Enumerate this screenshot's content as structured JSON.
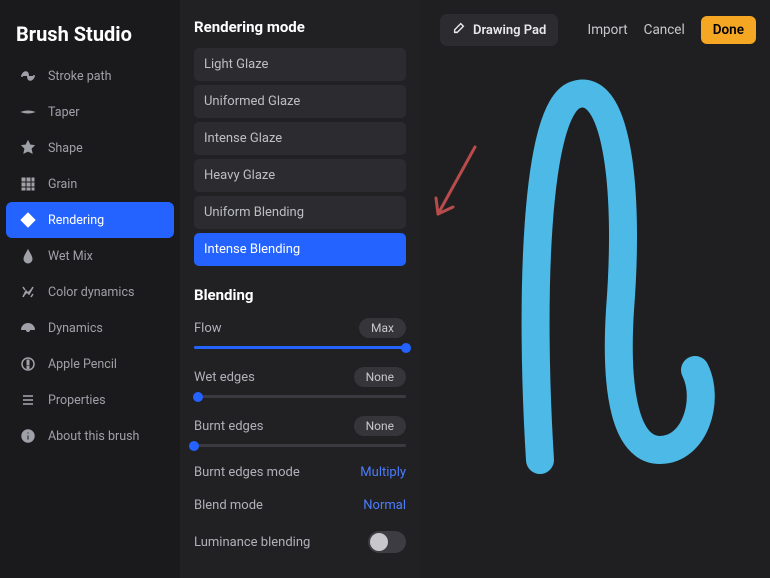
{
  "app_title": "Brush Studio",
  "sidebar": {
    "items": [
      {
        "label": "Stroke path",
        "icon": "stroke-path-icon"
      },
      {
        "label": "Taper",
        "icon": "taper-icon"
      },
      {
        "label": "Shape",
        "icon": "shape-icon"
      },
      {
        "label": "Grain",
        "icon": "grain-icon"
      },
      {
        "label": "Rendering",
        "icon": "rendering-icon",
        "active": true
      },
      {
        "label": "Wet Mix",
        "icon": "wet-mix-icon"
      },
      {
        "label": "Color dynamics",
        "icon": "color-dynamics-icon"
      },
      {
        "label": "Dynamics",
        "icon": "dynamics-icon"
      },
      {
        "label": "Apple Pencil",
        "icon": "apple-pencil-icon"
      },
      {
        "label": "Properties",
        "icon": "properties-icon"
      },
      {
        "label": "About this brush",
        "icon": "about-icon"
      }
    ]
  },
  "settings": {
    "heading": "Rendering mode",
    "modes": [
      {
        "label": "Light Glaze"
      },
      {
        "label": "Uniformed Glaze"
      },
      {
        "label": "Intense Glaze"
      },
      {
        "label": "Heavy Glaze"
      },
      {
        "label": "Uniform Blending"
      },
      {
        "label": "Intense Blending",
        "active": true
      }
    ],
    "blending": {
      "heading": "Blending",
      "flow": {
        "label": "Flow",
        "value": "Max",
        "percent": 100
      },
      "wet_edges": {
        "label": "Wet edges",
        "value": "None",
        "percent": 2
      },
      "burnt_edges": {
        "label": "Burnt edges",
        "value": "None",
        "percent": 0
      },
      "burnt_edges_mode": {
        "label": "Burnt edges mode",
        "value": "Multiply"
      },
      "blend_mode": {
        "label": "Blend mode",
        "value": "Normal"
      },
      "luminance": {
        "label": "Luminance blending",
        "on": false
      }
    }
  },
  "canvas": {
    "drawing_pad_label": "Drawing Pad",
    "import_label": "Import",
    "cancel_label": "Cancel",
    "done_label": "Done",
    "stroke_color": "#4db9e6",
    "arrow_color": "#b84b4b"
  }
}
